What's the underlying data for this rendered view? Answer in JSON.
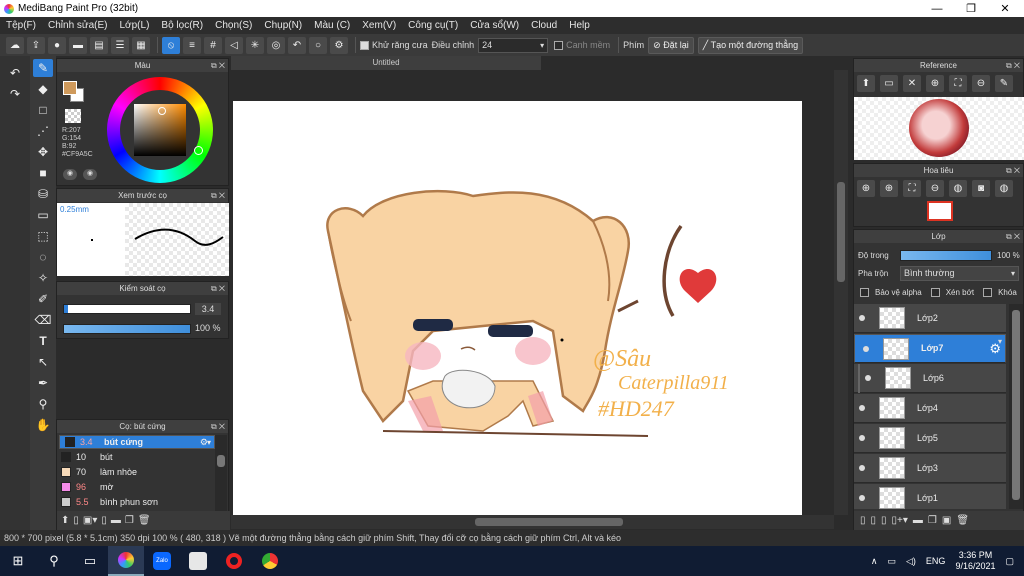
{
  "window": {
    "title": "MediBang Paint Pro (32bit)",
    "minimize": "—",
    "maximize": "❐",
    "close": "✕"
  },
  "menu": [
    "Tệp(F)",
    "Chỉnh sửa(E)",
    "Lớp(L)",
    "Bộ lọc(R)",
    "Chọn(S)",
    "Chụp(N)",
    "Màu (C)",
    "Xem(V)",
    "Công cụ(T)",
    "Cửa sổ(W)",
    "Cloud",
    "Help"
  ],
  "toolbar": {
    "antialias_label": "Khử răng cưa",
    "adjust_label": "Điều chỉnh",
    "adjust_value": "24",
    "margin_label": "Canh mềm",
    "key_label": "Phím",
    "reset_label": "Đặt lại",
    "line_label": "Tạo một đường thẳng"
  },
  "color_panel": {
    "title": "Màu",
    "rgb": "R:207\nG:154\nB:92\n#CF9A5C",
    "fg": "#CF9A5C"
  },
  "preview_panel": {
    "title": "Xem trước cọ",
    "size": "0.25mm"
  },
  "control_panel": {
    "title": "Kiểm soát cọ",
    "size": "3.4",
    "opacity": "100 %"
  },
  "brush_panel": {
    "title": "Cọ: bút cứng",
    "items": [
      {
        "size": "3.4",
        "name": "bút cứng",
        "color": "#222222"
      },
      {
        "size": "10",
        "name": "bút",
        "color": "#222222"
      },
      {
        "size": "70",
        "name": "làm nhòe",
        "color": "#f6d9b8"
      },
      {
        "size": "96",
        "name": "mờ",
        "color": "#f58ce8"
      },
      {
        "size": "5.5",
        "name": "bình phun sơn",
        "color": "#cccccc"
      }
    ]
  },
  "canvas": {
    "tab": "Untitled"
  },
  "reference_panel": {
    "title": "Reference"
  },
  "navigator_panel": {
    "title": "Hoa tiêu"
  },
  "layer_panel": {
    "title": "Lớp",
    "opacity_label": "Độ trong",
    "opacity_value": "100 %",
    "blend_label": "Pha trộn",
    "blend_value": "Bình thường",
    "protect_alpha": "Bảo vệ alpha",
    "clip": "Xén bớt",
    "lock": "Khóa",
    "layers": [
      "Lớp2",
      "Lớp7",
      "Lớp6",
      "Lớp4",
      "Lớp5",
      "Lớp3",
      "Lớp1"
    ]
  },
  "status": "800 * 700 pixel   (5.8 * 5.1cm)   350 dpi   100 %   ( 480, 318 )   Vẽ một đường thẳng bằng cách giữ phím Shift, Thay đổi cỡ cọ bằng cách giữ phím Ctrl, Alt và kéo",
  "taskbar": {
    "lang": "ENG",
    "time": "3:36 PM",
    "date": "9/16/2021"
  },
  "artwork": {
    "signature": "@Sâu\nCaterpilla911\n#HD247"
  }
}
